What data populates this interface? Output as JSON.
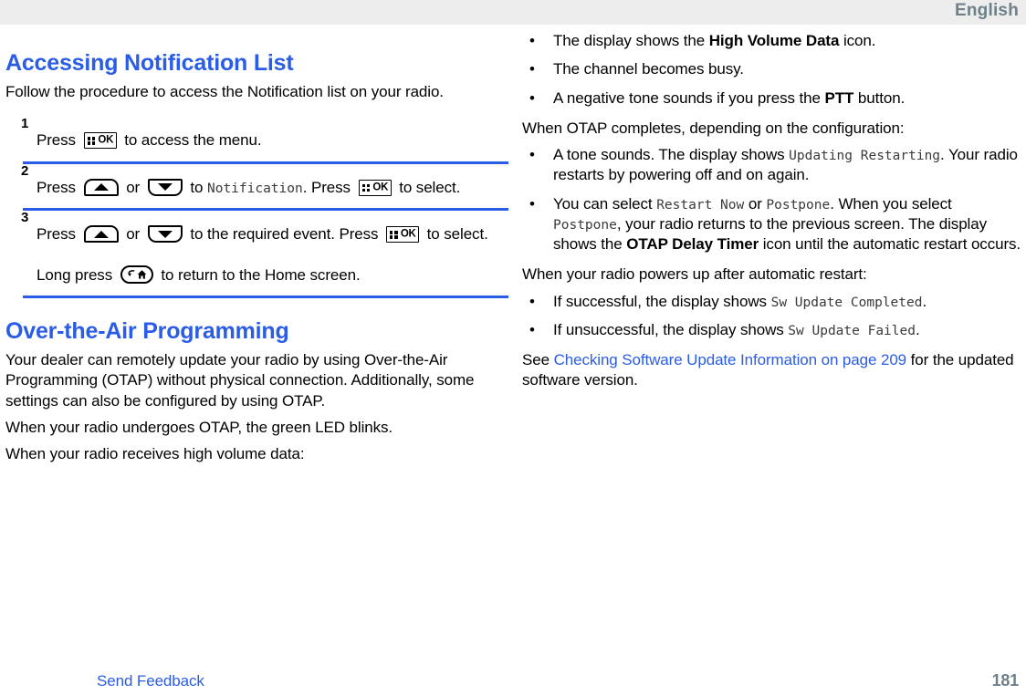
{
  "header": {
    "language": "English"
  },
  "footer": {
    "send_feedback": "Send Feedback",
    "page_number": "181"
  },
  "colors": {
    "heading_blue": "#2b5ce6",
    "link_blue": "#2b5ce6",
    "rule_blue": "#2b5ce6",
    "header_bg": "#ededed",
    "header_text": "#6e8189",
    "display_text": "#3a3a3a"
  },
  "left_column": {
    "section_1": {
      "heading": "Accessing Notification List",
      "intro": "Follow the procedure to access the Notification list on your radio.",
      "steps": [
        {
          "number": "1",
          "lines": [
            {
              "parts": [
                {
                  "type": "text",
                  "value": "Press "
                },
                {
                  "type": "icon",
                  "icon": "ok-menu-key"
                },
                {
                  "type": "text",
                  "value": " to access the menu."
                }
              ]
            }
          ]
        },
        {
          "number": "2",
          "lines": [
            {
              "parts": [
                {
                  "type": "text",
                  "value": "Press "
                },
                {
                  "type": "icon",
                  "icon": "up-arrow-key"
                },
                {
                  "type": "text",
                  "value": " or "
                },
                {
                  "type": "icon",
                  "icon": "down-arrow-key"
                },
                {
                  "type": "text",
                  "value": " to "
                },
                {
                  "type": "display",
                  "value": "Notification"
                },
                {
                  "type": "text",
                  "value": ". Press "
                },
                {
                  "type": "icon",
                  "icon": "ok-menu-key"
                },
                {
                  "type": "text",
                  "value": " to select."
                }
              ]
            }
          ]
        },
        {
          "number": "3",
          "lines": [
            {
              "parts": [
                {
                  "type": "text",
                  "value": "Press "
                },
                {
                  "type": "icon",
                  "icon": "up-arrow-key"
                },
                {
                  "type": "text",
                  "value": " or "
                },
                {
                  "type": "icon",
                  "icon": "down-arrow-key"
                },
                {
                  "type": "text",
                  "value": " to the required event. Press "
                },
                {
                  "type": "icon",
                  "icon": "ok-menu-key"
                },
                {
                  "type": "text",
                  "value": " to select."
                }
              ]
            },
            {
              "parts": [
                {
                  "type": "text",
                  "value": "Long press "
                },
                {
                  "type": "icon",
                  "icon": "back-home-key"
                },
                {
                  "type": "text",
                  "value": " to return to the Home screen."
                }
              ]
            }
          ]
        }
      ]
    },
    "section_2": {
      "heading": "Over-the-Air Programming",
      "paragraphs": [
        "Your dealer can remotely update your radio by using Over-the-Air Programming (OTAP) without physical connection. Additionally, some settings can also be configured by using OTAP.",
        "When your radio undergoes OTAP, the green LED blinks.",
        "When your radio receives high volume data:"
      ]
    }
  },
  "right_column": {
    "high_volume_bullets": [
      {
        "parts": [
          {
            "type": "text",
            "value": "The display shows the "
          },
          {
            "type": "bold",
            "value": "High Volume Data"
          },
          {
            "type": "text",
            "value": " icon."
          }
        ]
      },
      {
        "parts": [
          {
            "type": "text",
            "value": "The channel becomes busy."
          }
        ]
      },
      {
        "parts": [
          {
            "type": "text",
            "value": "A negative tone sounds if you press the "
          },
          {
            "type": "bold",
            "value": "PTT"
          },
          {
            "type": "text",
            "value": " button."
          }
        ]
      }
    ],
    "otap_completes_intro": "When OTAP completes, depending on the configuration:",
    "otap_completes_bullets": [
      {
        "parts": [
          {
            "type": "text",
            "value": "A tone sounds. The display shows "
          },
          {
            "type": "display",
            "value": "Updating Restarting"
          },
          {
            "type": "text",
            "value": ". Your radio restarts by powering off and on again."
          }
        ]
      },
      {
        "parts": [
          {
            "type": "text",
            "value": "You can select "
          },
          {
            "type": "display",
            "value": "Restart Now"
          },
          {
            "type": "text",
            "value": " or "
          },
          {
            "type": "display",
            "value": "Postpone"
          },
          {
            "type": "text",
            "value": ". When you select "
          },
          {
            "type": "display",
            "value": "Postpone"
          },
          {
            "type": "text",
            "value": ", your radio returns to the previous screen. The display shows the "
          },
          {
            "type": "bold",
            "value": "OTAP Delay Timer"
          },
          {
            "type": "text",
            "value": " icon until the automatic restart occurs."
          }
        ]
      }
    ],
    "powers_up_intro": "When your radio powers up after automatic restart:",
    "powers_up_bullets": [
      {
        "parts": [
          {
            "type": "text",
            "value": "If successful, the display shows "
          },
          {
            "type": "display",
            "value": "Sw Update Completed"
          },
          {
            "type": "text",
            "value": "."
          }
        ]
      },
      {
        "parts": [
          {
            "type": "text",
            "value": "If unsuccessful, the display shows "
          },
          {
            "type": "display",
            "value": "Sw Update Failed"
          },
          {
            "type": "text",
            "value": "."
          }
        ]
      }
    ],
    "see_also": {
      "prefix": "See ",
      "link_text": "Checking Software Update Information on page 209",
      "suffix": " for the updated software version."
    }
  },
  "icons": {
    "ok-menu-key": {
      "name": "ok-menu-key-icon",
      "label": "OK"
    },
    "up-arrow-key": {
      "name": "up-arrow-key-icon"
    },
    "down-arrow-key": {
      "name": "down-arrow-key-icon"
    },
    "back-home-key": {
      "name": "back-home-key-icon"
    }
  }
}
